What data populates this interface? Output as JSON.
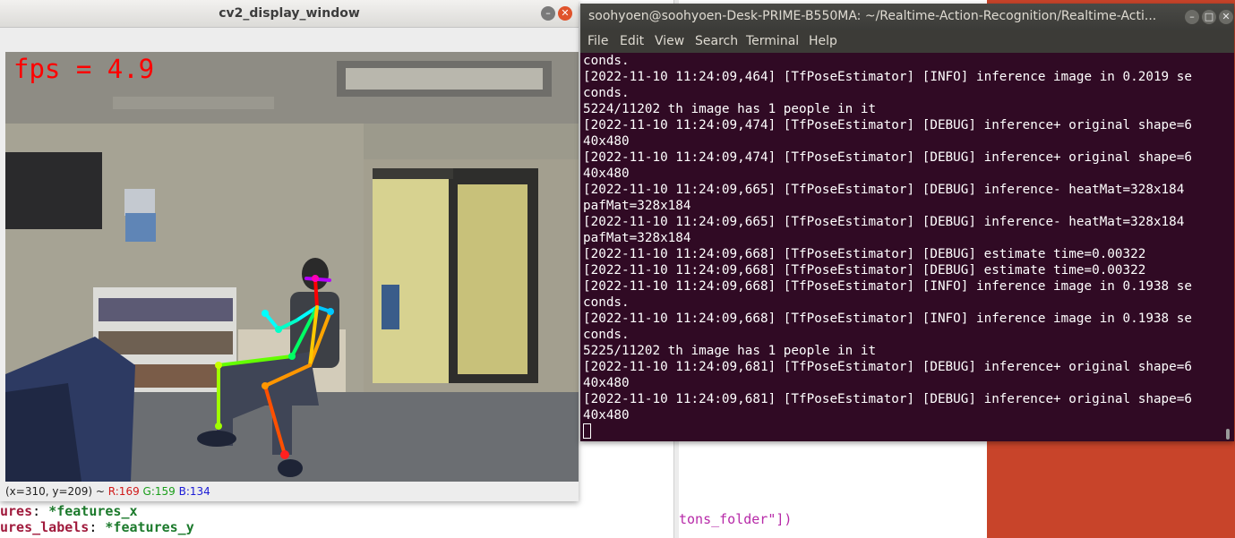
{
  "background": {
    "code_lines": [
      {
        "key": "ures",
        "sep": ": ",
        "val": "*features_x"
      },
      {
        "key": "ures_labels",
        "sep": ": ",
        "val": "*features_y"
      }
    ],
    "right_code": "tons_folder\"])",
    "colors": {
      "accent": "#c8442a"
    }
  },
  "cv_window": {
    "title": "cv2_display_window",
    "fps_text": "fps = 4.9",
    "status": {
      "coords": "(x=310, y=209) ~ ",
      "r": "R:169",
      "g": "G:159",
      "b": "B:134"
    },
    "icons": [
      "minimize-icon",
      "close-icon"
    ]
  },
  "terminal": {
    "title": "soohyoen@soohyoen-Desk-PRIME-B550MA: ~/Realtime-Action-Recognition/Realtime-Acti...",
    "menu": [
      "File",
      "Edit",
      "View",
      "Search",
      "Terminal",
      "Help"
    ],
    "lines": [
      "conds.",
      "[2022-11-10 11:24:09,464] [TfPoseEstimator] [INFO] inference image in 0.2019 se",
      "conds.",
      "5224/11202 th image has 1 people in it",
      "[2022-11-10 11:24:09,474] [TfPoseEstimator] [DEBUG] inference+ original shape=6",
      "40x480",
      "[2022-11-10 11:24:09,474] [TfPoseEstimator] [DEBUG] inference+ original shape=6",
      "40x480",
      "[2022-11-10 11:24:09,665] [TfPoseEstimator] [DEBUG] inference- heatMat=328x184",
      "pafMat=328x184",
      "[2022-11-10 11:24:09,665] [TfPoseEstimator] [DEBUG] inference- heatMat=328x184",
      "pafMat=328x184",
      "[2022-11-10 11:24:09,668] [TfPoseEstimator] [DEBUG] estimate time=0.00322",
      "[2022-11-10 11:24:09,668] [TfPoseEstimator] [DEBUG] estimate time=0.00322",
      "[2022-11-10 11:24:09,668] [TfPoseEstimator] [INFO] inference image in 0.1938 se",
      "conds.",
      "[2022-11-10 11:24:09,668] [TfPoseEstimator] [INFO] inference image in 0.1938 se",
      "conds.",
      "5225/11202 th image has 1 people in it",
      "[2022-11-10 11:24:09,681] [TfPoseEstimator] [DEBUG] inference+ original shape=6",
      "40x480",
      "[2022-11-10 11:24:09,681] [TfPoseEstimator] [DEBUG] inference+ original shape=6",
      "40x480"
    ],
    "colors": {
      "background": "#300a24",
      "text": "#ffffff"
    }
  }
}
